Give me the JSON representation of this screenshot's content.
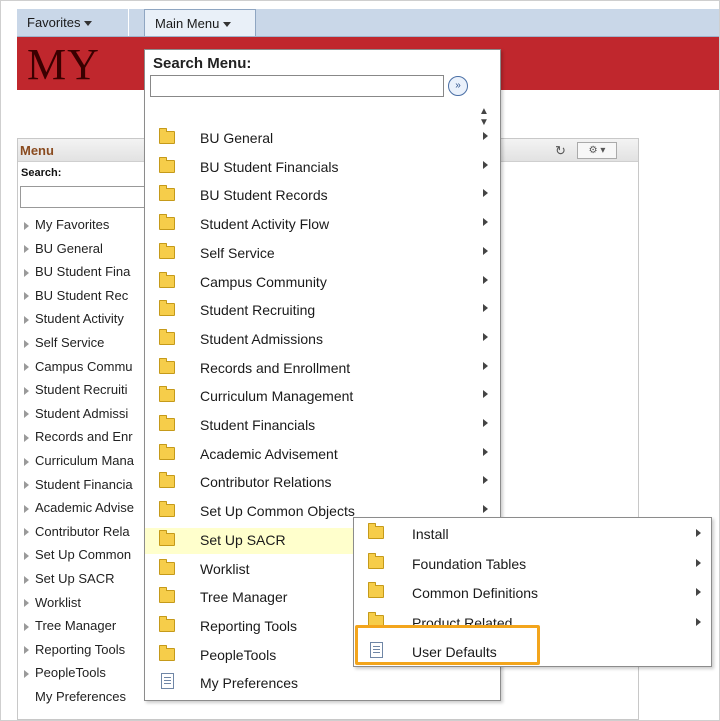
{
  "nav": {
    "favorites_label": "Favorites",
    "main_menu_label": "Main Menu"
  },
  "banner": {
    "logo_text": "MY"
  },
  "pagelet": {
    "title": "Menu",
    "search_label": "Search:",
    "items": [
      "My Favorites",
      "BU General",
      "BU Student Fina",
      "BU Student Rec",
      "Student Activity",
      "Self Service",
      "Campus Commu",
      "Student Recruiti",
      "Student Admissi",
      "Records and Enr",
      "Curriculum Mana",
      "Student Financia",
      "Academic Advise",
      "Contributor Rela",
      "Set Up Common",
      "Set Up SACR",
      "Worklist",
      "Tree Manager",
      "Reporting Tools",
      "PeopleTools",
      "My Preferences"
    ]
  },
  "dropdown": {
    "title": "Search Menu:",
    "search_value": "",
    "items": [
      "BU General",
      "BU Student Financials",
      "BU Student Records",
      "Student Activity Flow",
      "Self Service",
      "Campus Community",
      "Student Recruiting",
      "Student Admissions",
      "Records and Enrollment",
      "Curriculum Management",
      "Student Financials",
      "Academic Advisement",
      "Contributor Relations",
      "Set Up Common Objects",
      "Set Up SACR",
      "Worklist",
      "Tree Manager",
      "Reporting Tools",
      "PeopleTools",
      "My Preferences"
    ],
    "active_item": "Set Up SACR"
  },
  "submenu": {
    "items": [
      "Install",
      "Foundation Tables",
      "Common Definitions",
      "Product Related",
      "User Defaults"
    ],
    "highlighted_item": "User Defaults"
  },
  "colors": {
    "nav_bg": "#c9d7e8",
    "banner": "#c0272d",
    "highlight": "#f3a51c",
    "active_row": "#ffffcc"
  }
}
